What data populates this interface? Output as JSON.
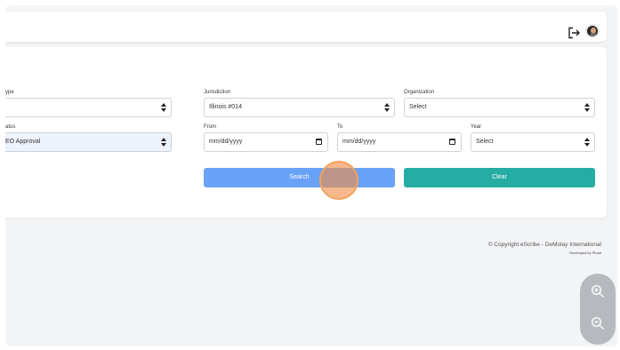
{
  "header": {
    "logout_icon": "logout-icon",
    "avatar_icon": "user-avatar"
  },
  "filters": {
    "type_label": "ype",
    "status_label": "atus",
    "status_value": "EO Approval",
    "jurisdiction_label": "Jurisdiction",
    "jurisdiction_value": "Illinois #014",
    "organization_label": "Organization",
    "organization_value": "Select",
    "from_label": "From",
    "from_placeholder": "mm/dd/yyyy",
    "to_label": "To",
    "to_placeholder": "mm/dd/yyyy",
    "year_label": "Year",
    "year_value": "Select"
  },
  "actions": {
    "search_label": "Search",
    "clear_label": "Clear"
  },
  "footer": {
    "copyright": "© Copyright eScribe - DeMolay International",
    "developer": "Developed by Plural"
  },
  "zoom": {
    "in_icon": "zoom-in-icon",
    "out_icon": "zoom-out-icon"
  },
  "colors": {
    "search_button": "#6aa2f7",
    "clear_button": "#25ada4",
    "background": "#f3f4f6"
  }
}
